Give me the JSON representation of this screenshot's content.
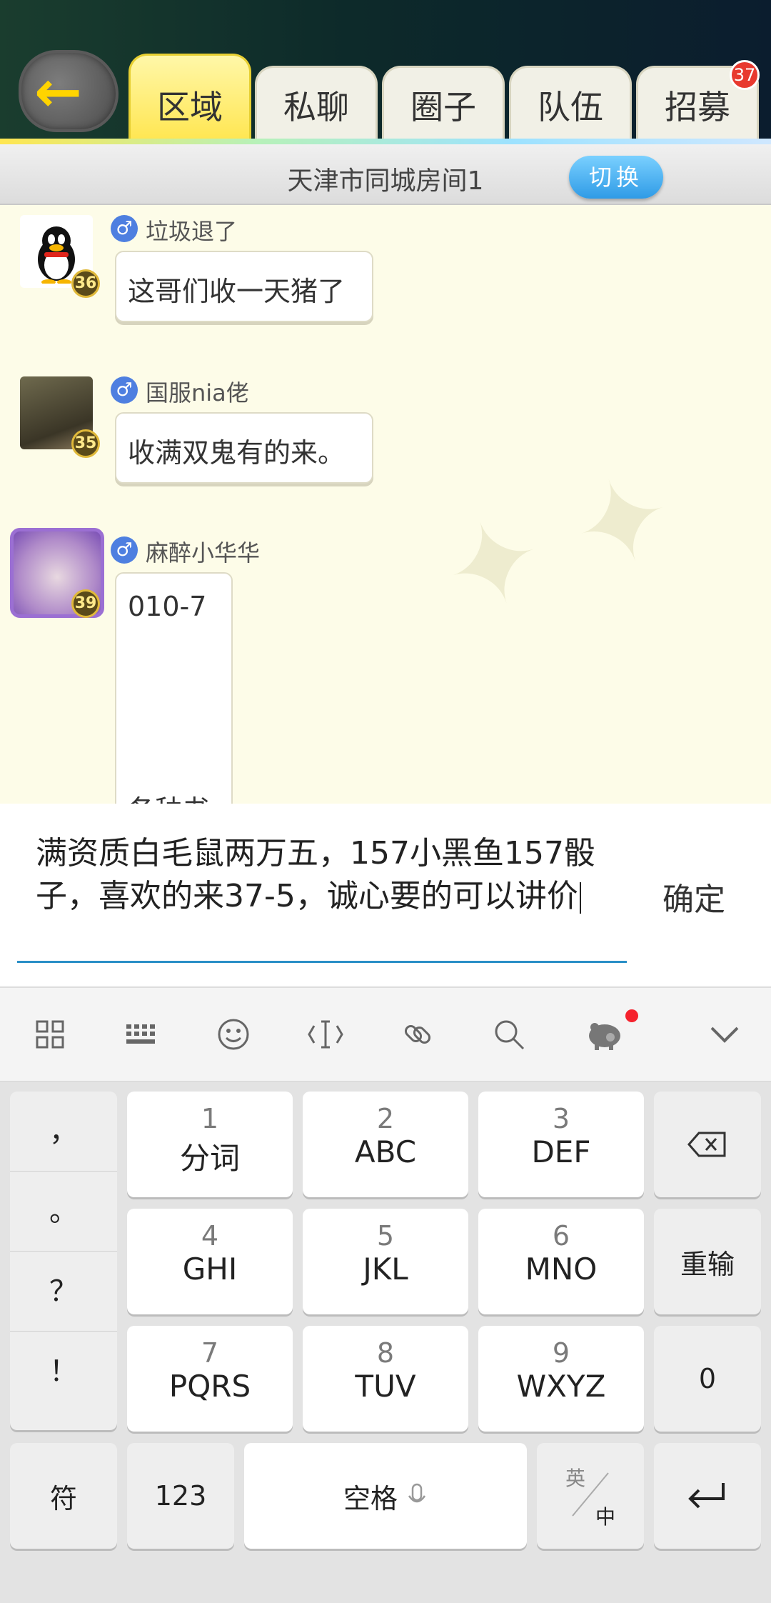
{
  "header": {
    "tabs": [
      "区域",
      "私聊",
      "圈子",
      "队伍",
      "招募"
    ],
    "active_tab": "区域",
    "recruit_badge": "37"
  },
  "room": {
    "title": "天津市同城房间1",
    "switch_label": "切换"
  },
  "messages": [
    {
      "name": "垃圾退了",
      "level": "36",
      "gender": "♂",
      "text": "这哥们收一天猪了"
    },
    {
      "name": "国服nia佬",
      "level": "35",
      "gender": "♂",
      "text": "收满双鬼有的来。"
    },
    {
      "name": "麻醉小华华",
      "level": "39",
      "gender": "♂",
      "text_line1": "010-7",
      "text_line2": "各种书"
    }
  ],
  "input": {
    "value": "满资质白毛鼠两万五，157小黑鱼157骰子，喜欢的来37-5，诚心要的可以讲价",
    "confirm_label": "确定"
  },
  "keyboard": {
    "punctuation": [
      "，",
      "。",
      "？",
      "！"
    ],
    "keys": [
      {
        "num": "1",
        "letters": "分词"
      },
      {
        "num": "2",
        "letters": "ABC"
      },
      {
        "num": "3",
        "letters": "DEF"
      },
      {
        "num": "4",
        "letters": "GHI"
      },
      {
        "num": "5",
        "letters": "JKL"
      },
      {
        "num": "6",
        "letters": "MNO"
      },
      {
        "num": "7",
        "letters": "PQRS"
      },
      {
        "num": "8",
        "letters": "TUV"
      },
      {
        "num": "9",
        "letters": "WXYZ"
      }
    ],
    "backspace_icon": "backspace-icon",
    "retype_label": "重输",
    "zero_label": "0",
    "symbol_label": "符",
    "numbers_label": "123",
    "space_label": "空格",
    "lang_top": "英",
    "lang_bottom": "中",
    "enter_icon": "enter-icon"
  },
  "colors": {
    "active_tab": "#ffe651",
    "switch_button": "#2f9be6",
    "input_underline": "#2a8fc7",
    "badge": "#e8392f"
  }
}
